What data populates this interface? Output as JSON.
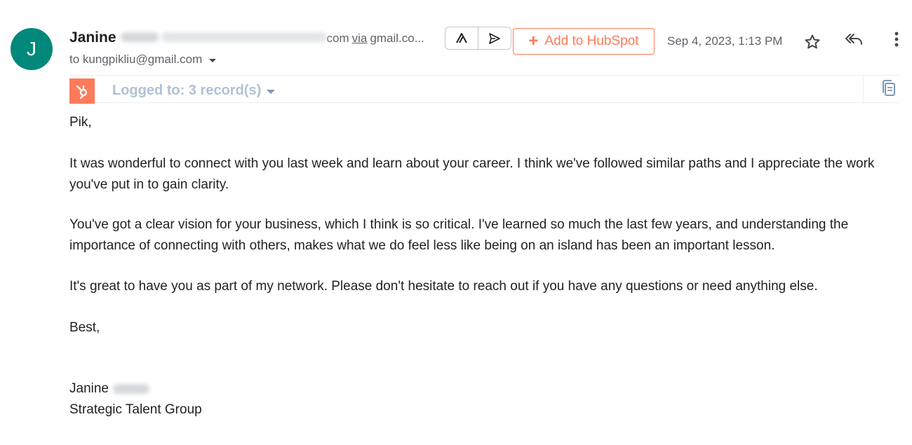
{
  "sender": {
    "avatar_letter": "J",
    "avatar_color": "#00897b",
    "name": "Janine",
    "email_tail": "com",
    "via_word": "via",
    "via_domain": "gmail.co...",
    "to_line": "to kungpikliu@gmail.com"
  },
  "toolbar": {
    "hubspot_button_plus": "+",
    "hubspot_button_label": "Add to HubSpot",
    "date": "Sep 4, 2023, 1:13 PM",
    "icons": [
      "ai-assist-icon",
      "send-icon",
      "star-icon",
      "reply-all-icon",
      "more-vert-icon"
    ]
  },
  "hubspot": {
    "logged_label": "Logged to: 3 record(s)",
    "brand_color": "#ff7a59"
  },
  "body": {
    "greeting": "Pik,",
    "paragraph1": "It was wonderful to connect with you last week and learn about your career. I think we've followed similar paths and I appreciate the work you've put in to gain clarity.",
    "paragraph2": "You've got a clear vision for your business, which I think is so critical. I've learned so much the last few years, and understanding the importance of connecting with others, makes what we do feel less like being on an island has been an important lesson.",
    "paragraph3": "It's great to have you as part of my network. Please don't hesitate to reach out if you have any questions or need anything else.",
    "closing": "Best,",
    "signature_name": "Janine",
    "signature_company": "Strategic Talent Group"
  }
}
